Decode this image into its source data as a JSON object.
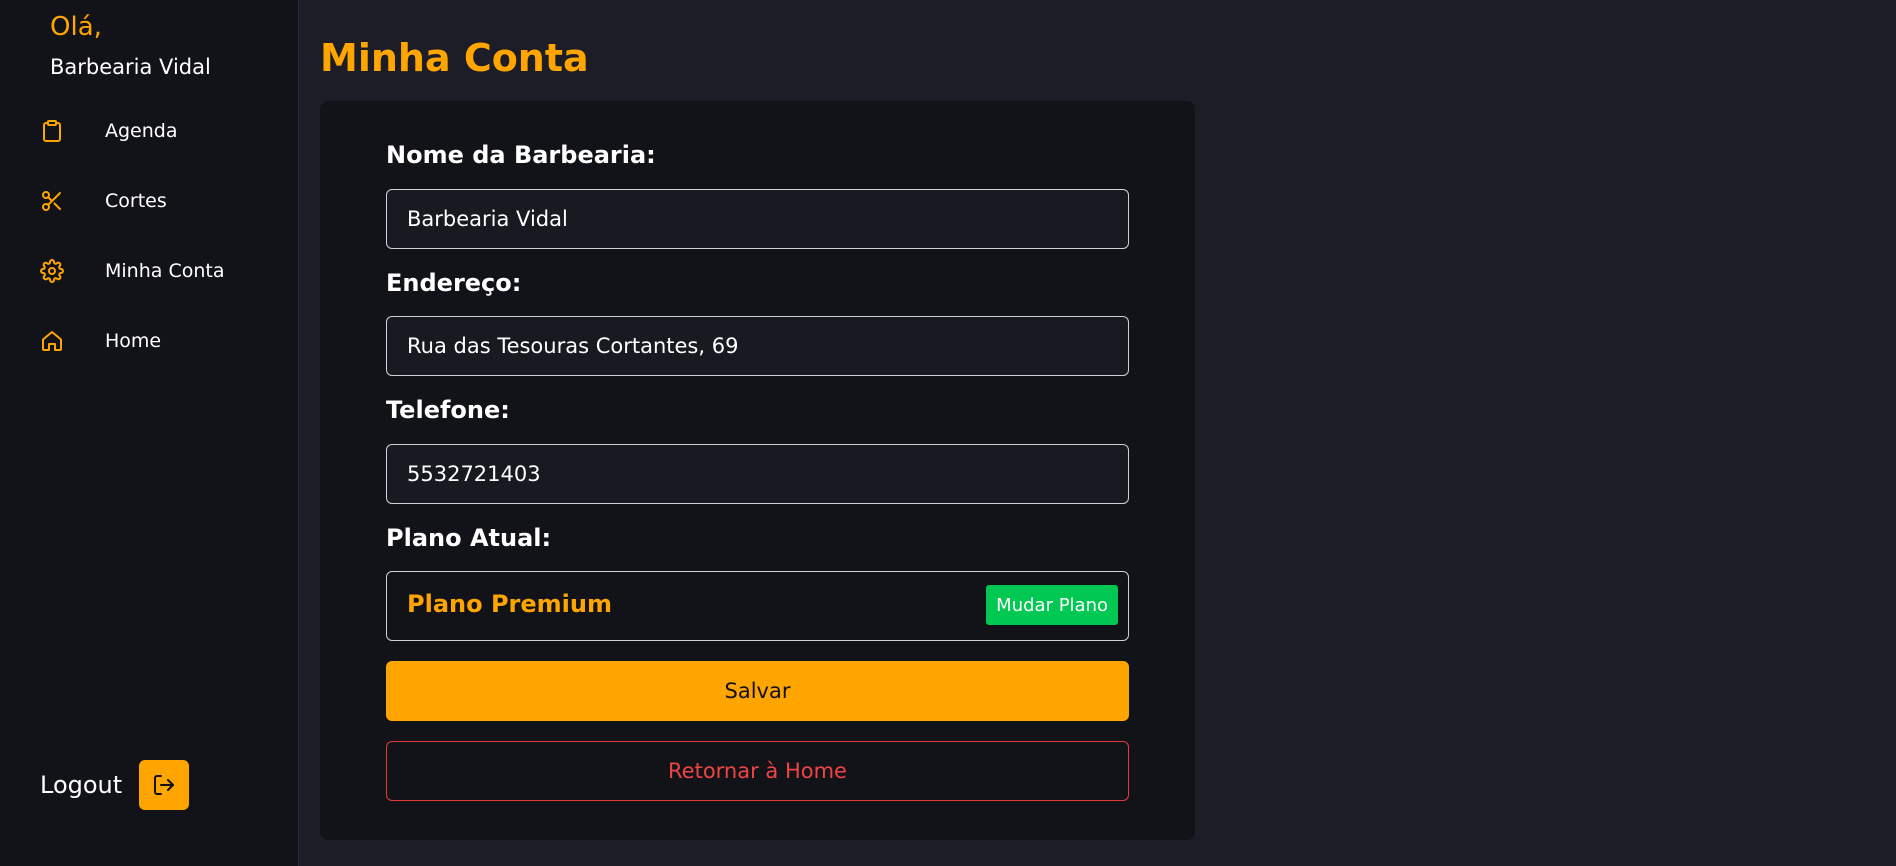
{
  "sidebar": {
    "greeting": "Olá,",
    "shop_name": "Barbearia Vidal",
    "items": [
      {
        "label": "Agenda",
        "icon": "clipboard-icon"
      },
      {
        "label": "Cortes",
        "icon": "scissors-icon"
      },
      {
        "label": "Minha Conta",
        "icon": "gear-icon"
      },
      {
        "label": "Home",
        "icon": "home-icon"
      }
    ],
    "logout_label": "Logout",
    "logout_icon": "logout-icon"
  },
  "page": {
    "title": "Minha Conta"
  },
  "form": {
    "name_label": "Nome da Barbearia:",
    "name_value": "Barbearia Vidal",
    "address_label": "Endereço:",
    "address_value": "Rua das Tesouras Cortantes, 69",
    "phone_label": "Telefone:",
    "phone_value": "5532721403",
    "plan_label": "Plano Atual:",
    "plan_value": "Plano Premium",
    "change_plan_label": "Mudar Plano",
    "save_label": "Salvar",
    "return_label": "Retornar à Home"
  },
  "colors": {
    "accent": "#ffa500",
    "background": "#1c1d26",
    "sidebar": "#121319",
    "success": "#00c853",
    "danger": "#ef4444"
  }
}
